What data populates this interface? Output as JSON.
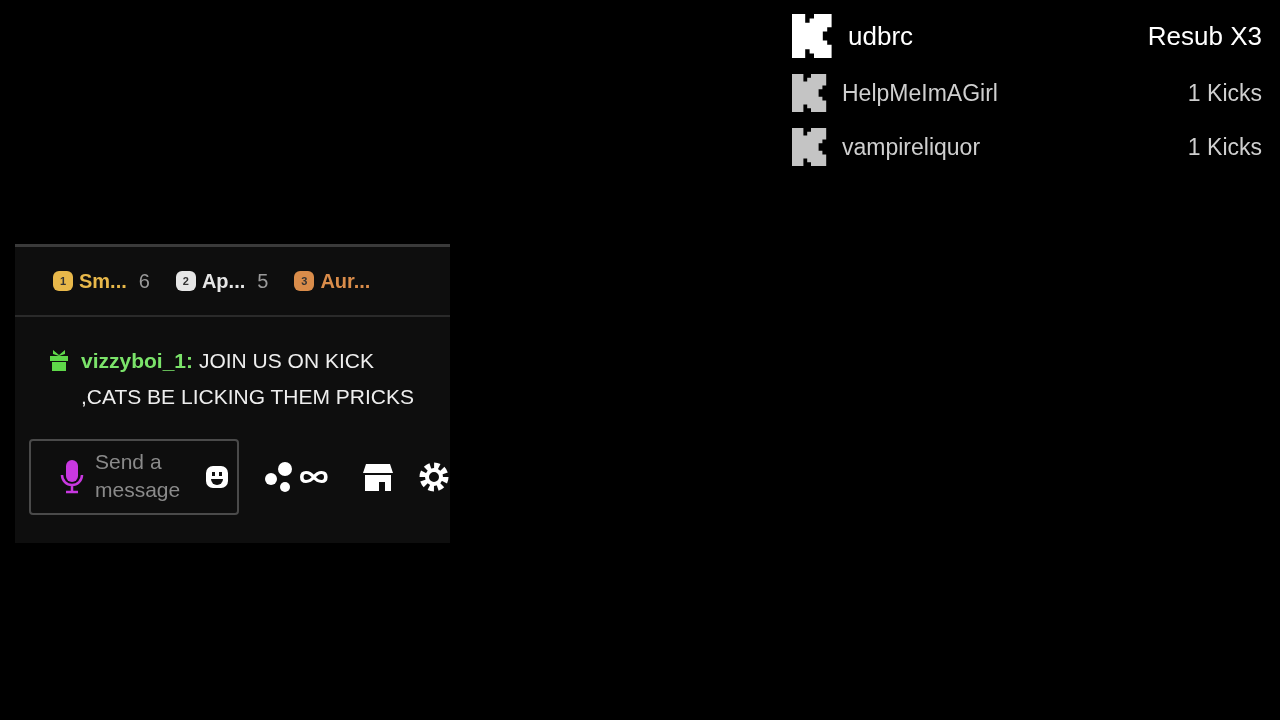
{
  "events": [
    {
      "kind": "featured",
      "user": "udbrc",
      "action": "Resub X3"
    },
    {
      "kind": "normal",
      "user": "HelpMeImAGirl",
      "action": "1 Kicks"
    },
    {
      "kind": "normal",
      "user": "vampireliquor",
      "action": "1 Kicks"
    }
  ],
  "chat": {
    "leaderboard": [
      {
        "rank": "1",
        "name": "Sm...",
        "count": "6",
        "color": "#e8b84a"
      },
      {
        "rank": "2",
        "name": "Ap...",
        "count": "5",
        "color": "#e6e6e6"
      },
      {
        "rank": "3",
        "name": "Aur...",
        "color": "#d98c4a"
      }
    ],
    "message": {
      "user": "vizzyboi_1:",
      "text": "JOIN US ON KICK ,CATS BE LICKING THEM PRICKS"
    },
    "input": {
      "placeholder": "Send a message"
    }
  }
}
